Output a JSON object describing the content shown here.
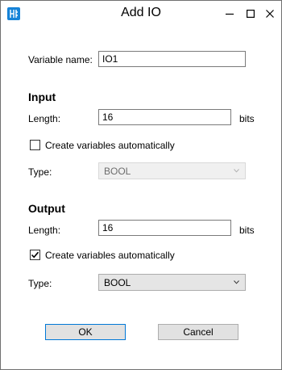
{
  "window": {
    "title": "Add IO"
  },
  "titlebar": {
    "icons": {
      "app": "app-logo-icon",
      "minimize": "minimize-icon",
      "maximize": "maximize-icon",
      "close": "close-icon"
    }
  },
  "form": {
    "variable_name_label": "Variable name:",
    "variable_name_value": "IO1"
  },
  "input": {
    "section_title": "Input",
    "length_label": "Length:",
    "length_value": "16",
    "length_unit": "bits",
    "create_vars_label": "Create variables automatically",
    "create_vars_checked": false,
    "type_label": "Type:",
    "type_value": "BOOL",
    "type_enabled": false
  },
  "output": {
    "section_title": "Output",
    "length_label": "Length:",
    "length_value": "16",
    "length_unit": "bits",
    "create_vars_label": "Create variables automatically",
    "create_vars_checked": true,
    "type_label": "Type:",
    "type_value": "BOOL",
    "type_enabled": true
  },
  "buttons": {
    "ok_label": "OK",
    "cancel_label": "Cancel"
  },
  "colors": {
    "accent": "#0078d7",
    "app_icon": "#1683d8",
    "border": "#7a7a7a"
  }
}
